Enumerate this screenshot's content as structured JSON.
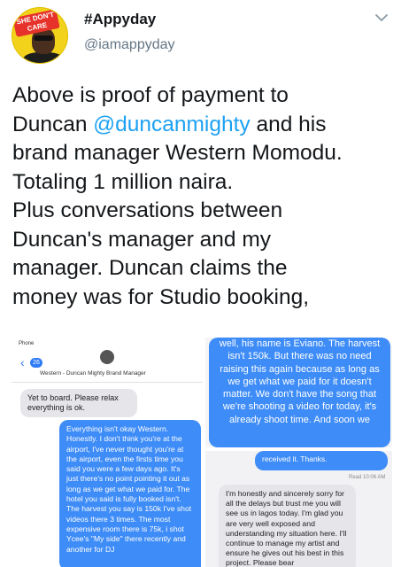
{
  "tweet": {
    "display_name": "#Appyday",
    "handle": "@iamappyday",
    "avatar_badge": "SHE DON'T CARE",
    "text_before_mention": "Above is proof of payment to\nDuncan ",
    "mention": "@duncanmighty",
    "text_after_mention": " and his\nbrand manager Western Momodu.\nTotaling 1 million naira.\nPlus conversations between\nDuncan's manager and my\nmanager. Duncan claims the\nmoney was for Studio booking,"
  },
  "media": {
    "left_screenshot": {
      "status": "Phone",
      "back_count": "26",
      "contact_name": "Western - Duncan Mighty Brand Manager",
      "messages": [
        {
          "direction": "incoming",
          "text": "Yet to board. Please relax everything is ok."
        },
        {
          "direction": "outgoing",
          "text": "Everything isn't okay Western. Honestly. I don't think you're at the airport, I've never thought you're at the airport, even the firsts time you said you were a few days ago. It's just there's no point pointing it out as long as we get what we paid for. The hotel you said is fully booked isn't. The harvest you say is 150k I've shot videos there 3 times. The most expensive room there is 75k, i shot Ycee's \"My side\" there recently and another for DJ"
        }
      ]
    },
    "right_top_screenshot": {
      "messages": [
        {
          "direction": "outgoing",
          "text": "well, his name is Eviano. The harvest isn't 150k. But there was no need raising this again because as long as we get what we paid for it doesn't matter. We don't have the song that we're shooting a video for today, it's already shoot time. And soon we"
        }
      ]
    },
    "right_bottom_screenshot": {
      "read_receipt": "Read 10:06 AM",
      "messages": [
        {
          "direction": "outgoing",
          "text": "received it. Thanks."
        },
        {
          "direction": "incoming",
          "text": "I'm honestly and sincerely sorry for all the delays but trust me you will see us in lagos today. I'm glad you are very well exposed and understanding my situation here. I'll continue to manage my artist and ensure he gives out his best in this project. Please bear"
        }
      ]
    }
  },
  "colors": {
    "mention": "#1da1f2",
    "imessage_blue": "#3e8cf7",
    "imessage_gray": "#e5e5ea"
  }
}
